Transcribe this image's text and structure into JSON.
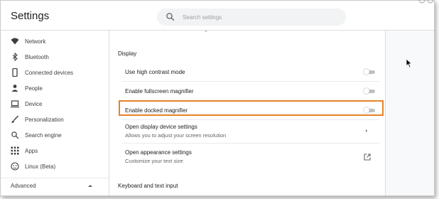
{
  "app": {
    "title": "Settings"
  },
  "search": {
    "placeholder": "Search settings",
    "icon": "search-icon"
  },
  "sidebar": {
    "items": [
      {
        "label": "Network",
        "icon": "wifi-icon"
      },
      {
        "label": "Bluetooth",
        "icon": "bluetooth-icon"
      },
      {
        "label": "Connected devices",
        "icon": "phone-icon"
      },
      {
        "label": "People",
        "icon": "person-icon"
      },
      {
        "label": "Device",
        "icon": "laptop-icon"
      },
      {
        "label": "Personalization",
        "icon": "brush-icon"
      },
      {
        "label": "Search engine",
        "icon": "search-icon"
      },
      {
        "label": "Apps",
        "icon": "apps-grid-icon"
      },
      {
        "label": "Linux (Beta)",
        "icon": "linux-icon"
      }
    ],
    "advanced_label": "Advanced"
  },
  "main": {
    "display_title": "Display",
    "rows": [
      {
        "label": "Use high contrast mode",
        "type": "toggle",
        "on": false
      },
      {
        "label": "Enable fullscreen magnifier",
        "type": "toggle",
        "on": false
      },
      {
        "label": "Enable docked magnifier",
        "type": "toggle",
        "on": false,
        "highlighted": true
      },
      {
        "label": "Open display device settings",
        "sub": "Allows you to adjust your screen resolution",
        "type": "link"
      },
      {
        "label": "Open appearance settings",
        "sub": "Customize your text size",
        "type": "external"
      }
    ],
    "keyboard_title": "Keyboard and text input"
  },
  "colors": {
    "highlight": "#e8822a",
    "toggle_track": "#bdc1c6",
    "icon": "#5f6368"
  }
}
